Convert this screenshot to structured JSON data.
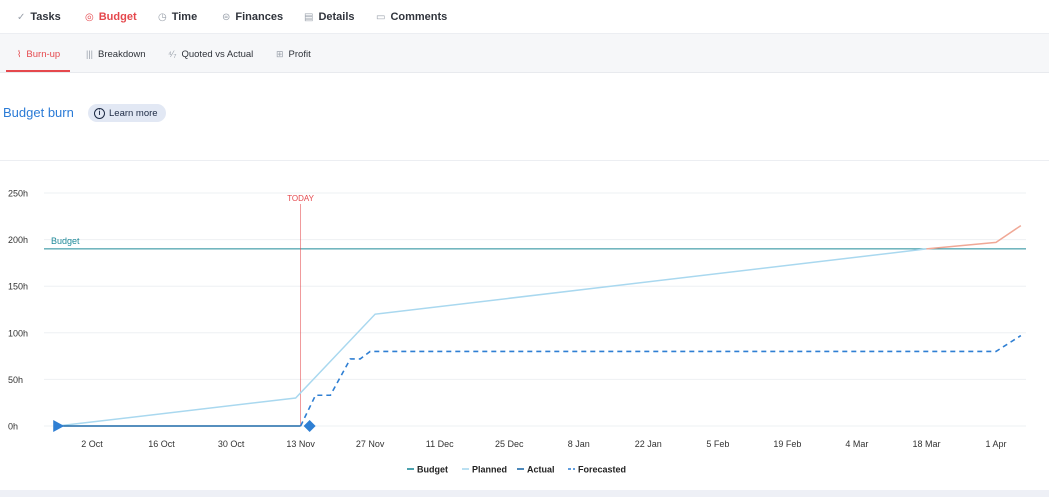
{
  "top_tabs": [
    {
      "label": "Tasks",
      "icon": "check-icon",
      "active": false
    },
    {
      "label": "Budget",
      "icon": "budget-icon",
      "active": true
    },
    {
      "label": "Time",
      "icon": "clock-icon",
      "active": false
    },
    {
      "label": "Finances",
      "icon": "coins-icon",
      "active": false
    },
    {
      "label": "Details",
      "icon": "document-icon",
      "active": false
    },
    {
      "label": "Comments",
      "icon": "comment-icon",
      "active": false
    }
  ],
  "sub_tabs": [
    {
      "label": "Burn-up",
      "icon": "burnup-icon",
      "active": true
    },
    {
      "label": "Breakdown",
      "icon": "bar-icon",
      "active": false
    },
    {
      "label": "Quoted vs Actual",
      "icon": "compare-icon",
      "active": false
    },
    {
      "label": "Profit",
      "icon": "profit-icon",
      "active": false
    }
  ],
  "section": {
    "title": "Budget burn",
    "learn_more": "Learn more"
  },
  "colors": {
    "accent_red": "#e5484d",
    "link_blue": "#2b7bd6",
    "budget": "#1f8a99",
    "planned": "#a9d8ef",
    "planned_over": "#f0a896",
    "actual": "#1f6aa8",
    "forecasted": "#2f7fd3",
    "today": "#e5484d"
  },
  "chart_data": {
    "type": "line",
    "x_tick_labels": [
      "2 Oct",
      "16 Oct",
      "30 Oct",
      "13 Nov",
      "27 Nov",
      "11 Dec",
      "25 Dec",
      "8 Jan",
      "22 Jan",
      "5 Feb",
      "19 Feb",
      "4 Mar",
      "18 Mar",
      "1 Apr"
    ],
    "y_tick_labels": [
      "0h",
      "50h",
      "100h",
      "150h",
      "200h",
      "250h"
    ],
    "ylim": [
      0,
      250
    ],
    "today_label": "TODAY",
    "today_date": "13 Nov",
    "budget_label": "Budget",
    "budget_value": 190,
    "legend": [
      "Budget",
      "Planned",
      "Actual",
      "Forecasted"
    ],
    "legend_position": "bottom-center",
    "series": [
      {
        "name": "Planned",
        "points": [
          [
            "25 Sep",
            0
          ],
          [
            "12 Nov",
            30
          ],
          [
            "28 Nov",
            120
          ],
          [
            "18 Mar",
            190
          ],
          [
            "1 Apr",
            197
          ],
          [
            "6 Apr",
            215
          ]
        ]
      },
      {
        "name": "Actual",
        "points": [
          [
            "25 Sep",
            0
          ],
          [
            "13 Nov",
            0
          ]
        ]
      },
      {
        "name": "Forecasted",
        "points": [
          [
            "13 Nov",
            0
          ],
          [
            "16 Nov",
            33
          ],
          [
            "19 Nov",
            33
          ],
          [
            "23 Nov",
            72
          ],
          [
            "25 Nov",
            72
          ],
          [
            "27 Nov",
            80
          ],
          [
            "1 Apr",
            80
          ],
          [
            "6 Apr",
            97
          ]
        ]
      }
    ]
  }
}
